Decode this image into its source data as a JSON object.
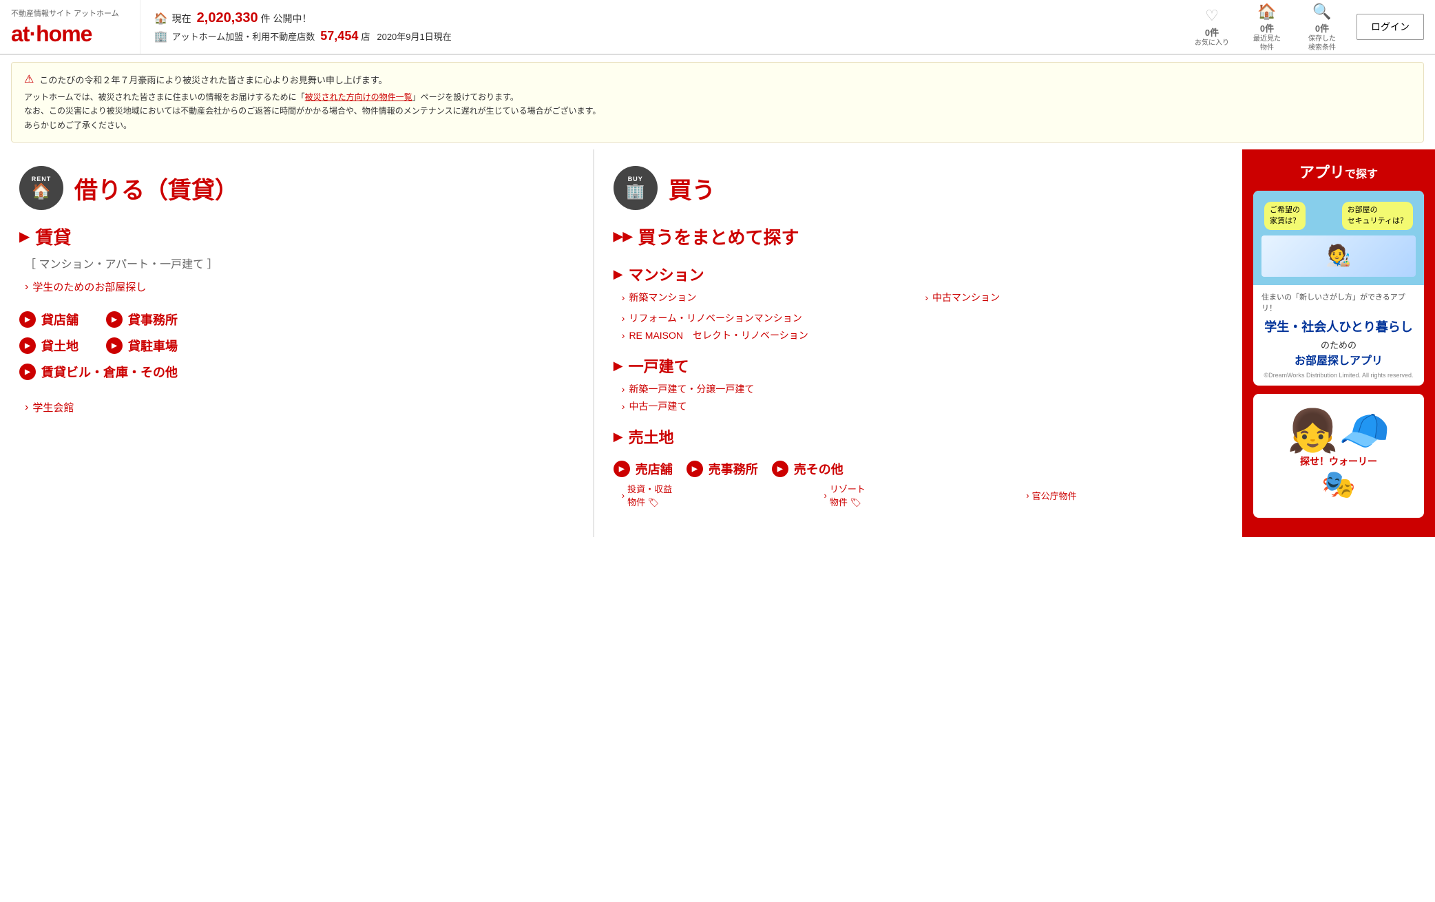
{
  "header": {
    "site_label": "不動産情報サイト アットホーム",
    "logo_text": "at·home",
    "stat1_prefix": "現在",
    "stat1_number": "2,020,330",
    "stat1_unit": "件 公開中！",
    "stat2_prefix": "アットホーム加盟・利用不動産店数",
    "stat2_number": "57,454",
    "stat2_unit": "店",
    "stat2_date": "2020年9月1日現在",
    "favorite_count": "0件",
    "favorite_label": "お気に入り",
    "recent_count": "0件",
    "recent_label": "最近見た\n物件",
    "saved_count": "0件",
    "saved_label": "保存した\n検索条件",
    "login_label": "ログイン"
  },
  "notice": {
    "title": "このたびの令和２年７月豪雨により被災された皆さまに心よりお見舞い申し上げます。",
    "body1": "アットホームでは、被災された皆さまに住まいの情報をお届けするために「被災された方向けの物件一覧」ページを設けております。",
    "body2": "なお、この災害により被災地域においては不動産会社からのご返答に時間がかかる場合や、物件情報のメンテナンスに遅れが生じている場合がございます。",
    "body3": "あらかじめご了承ください。",
    "link_text": "被災された方向けの物件一覧"
  },
  "rent": {
    "circle_label": "RENT",
    "panel_title": "借りる（賃貸）",
    "section1_title": "賃貸",
    "section1_sub": "［ マンション・アパート・一戸建て ］",
    "sub_link1": "学生のためのお部屋探し",
    "cat1_label": "貸店舗",
    "cat2_label": "貸事務所",
    "cat3_label": "貸土地",
    "cat4_label": "貸駐車場",
    "cat5_label": "賃貸ビル・倉庫・その他",
    "sub_link2": "学生会館"
  },
  "buy": {
    "circle_label": "BUY",
    "panel_title": "買う",
    "section1_title": "買うをまとめて探す",
    "mansion_title": "マンション",
    "mansion_link1": "新築マンション",
    "mansion_link2": "中古マンション",
    "mansion_link3": "リフォーム・リノベーションマンション",
    "mansion_link4": "RE MAISON　セレクト・リノベーション",
    "ikkodaite_title": "一戸建て",
    "ikkodaite_link1": "新築一戸建て・分譲一戸建て",
    "ikkodaite_link2": "中古一戸建て",
    "urichi_title": "売土地",
    "sell_row_title1": "売店舗",
    "sell_row_title2": "売事務所",
    "sell_row_title3": "売その他",
    "bottom_link1": "投資・収益\n物件",
    "bottom_link2": "リゾート\n物件",
    "bottom_link3": "官公庁物件"
  },
  "app": {
    "title": "アプリで探す",
    "bubble1": "ご希望の\n家賃は？",
    "bubble2": "お部屋の\nセキュリティは？",
    "tagline": "住まいの「新しいさがし方」ができるアプリ！",
    "big_text1": "学生・社会人ひとり暮らし",
    "big_text2": "のための",
    "sub_text": "お部屋探しアプリ",
    "copyright": "©DreamWorks Distribution Limited. All rights reserved."
  }
}
